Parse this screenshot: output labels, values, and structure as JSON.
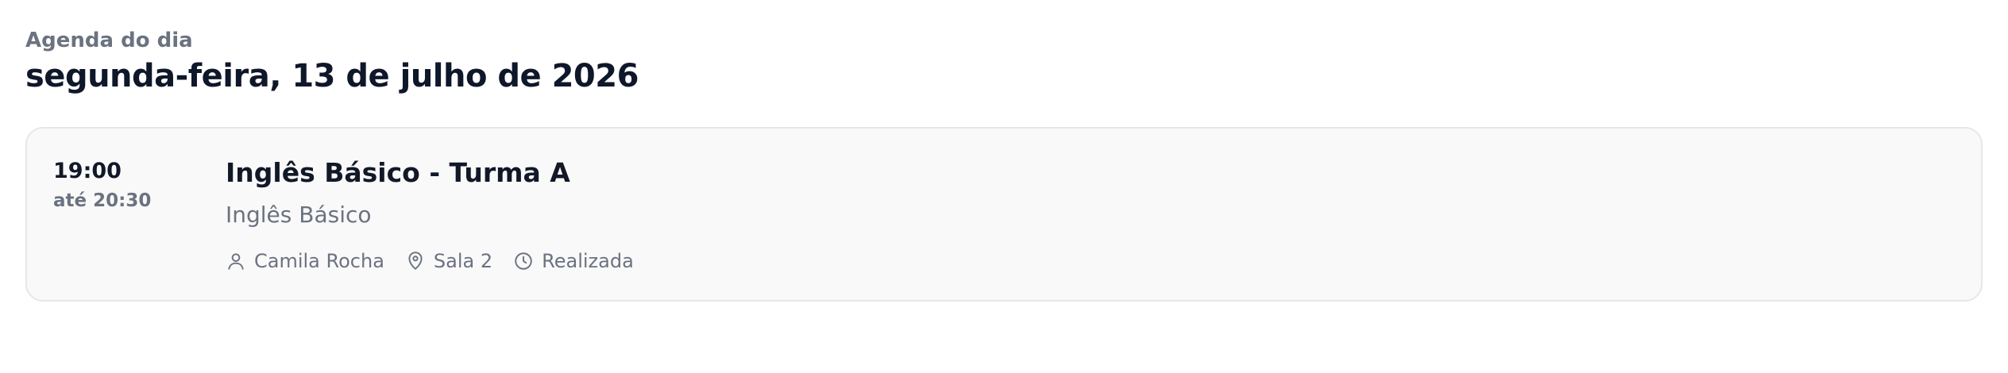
{
  "header": {
    "kicker": "Agenda do dia",
    "date": "segunda-feira, 13 de julho de 2026"
  },
  "agenda": {
    "items": [
      {
        "start_time": "19:00",
        "end_time": "até 20:30",
        "title": "Inglês Básico - Turma A",
        "subtitle": "Inglês Básico",
        "teacher": "Camila Rocha",
        "room": "Sala 2",
        "status": "Realizada",
        "teacher_icon": "user-icon",
        "room_icon": "map-pin-icon",
        "status_icon": "clock-icon"
      }
    ]
  },
  "colors": {
    "card_background": "#f9f9f9",
    "card_border": "#e5e7eb",
    "primary_text": "#111827",
    "muted_text": "#6b7280"
  }
}
